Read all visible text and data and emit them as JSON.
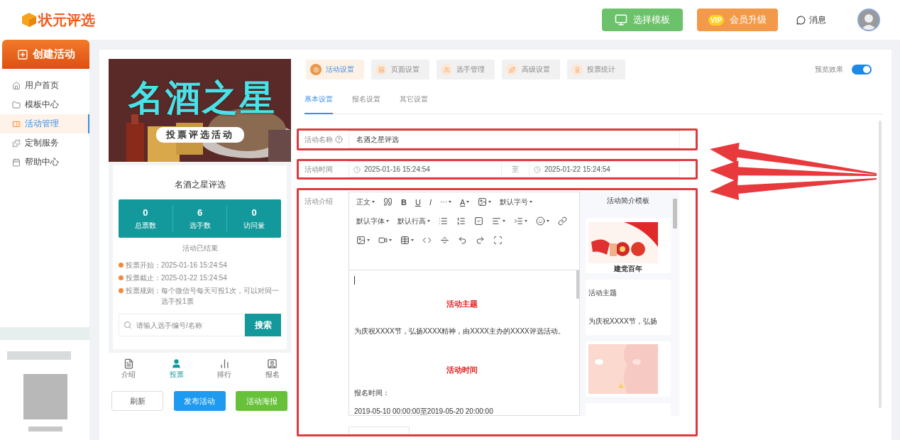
{
  "header": {
    "logo": "状元评选",
    "buttons": [
      {
        "label": "选择模板",
        "kind": "template"
      },
      {
        "label": "会员升级",
        "kind": "vip",
        "badge": "VIP"
      }
    ],
    "messages": "消息"
  },
  "sidebar": {
    "create": "创建活动",
    "items": [
      {
        "label": "用户首页",
        "selected": false
      },
      {
        "label": "模板中心",
        "selected": false
      },
      {
        "label": "活动管理",
        "selected": true
      },
      {
        "label": "定制服务",
        "selected": false
      },
      {
        "label": "帮助中心",
        "selected": false
      }
    ]
  },
  "preview": {
    "banner_title": "名酒之星",
    "banner_subtitle": "投票评选活动",
    "title": "名酒之星评选",
    "stats": [
      {
        "value": "0",
        "label": "总票数"
      },
      {
        "value": "6",
        "label": "选手数"
      },
      {
        "value": "0",
        "label": "访问量"
      }
    ],
    "status": "活动已结束",
    "rules": [
      {
        "label": "投票开始：",
        "text": "2025-01-16 15:24:54"
      },
      {
        "label": "投票截止：",
        "text": "2025-01-22 15:24:54"
      },
      {
        "label": "投票规则：",
        "text": "每个微信号每天可投1次，可以对同一选手投1票"
      }
    ],
    "search": {
      "placeholder": "请输入选手编号/名称",
      "button": "搜索"
    },
    "nav": [
      {
        "label": "介绍",
        "selected": false
      },
      {
        "label": "投票",
        "selected": true
      },
      {
        "label": "排行",
        "selected": false
      },
      {
        "label": "报名",
        "selected": false
      }
    ],
    "buttons": [
      {
        "label": "刷新",
        "kind": "plain"
      },
      {
        "label": "发布活动",
        "kind": "primary"
      },
      {
        "label": "活动海报",
        "kind": "success"
      }
    ]
  },
  "settings": {
    "tabs": [
      {
        "label": "活动设置",
        "selected": true
      },
      {
        "label": "页面设置",
        "selected": false
      },
      {
        "label": "选手管理",
        "selected": false
      },
      {
        "label": "高级设置",
        "selected": false
      },
      {
        "label": "投票统计",
        "selected": false
      }
    ],
    "preview_toggle": {
      "label": "预览效果",
      "on": true
    },
    "subtabs": [
      {
        "label": "基本设置",
        "selected": true
      },
      {
        "label": "报名设置",
        "selected": false
      },
      {
        "label": "其它设置",
        "selected": false
      }
    ],
    "name_field": {
      "label": "活动名称",
      "value": "名酒之星评选"
    },
    "time_field": {
      "label": "活动时间",
      "start": "2025-01-16 15:24:54",
      "separator": "至",
      "end": "2025-01-22 15:24:54"
    },
    "intro": {
      "label": "活动介绍",
      "toolbar_labels": [
        "正文",
        "B",
        "U",
        "I",
        "···",
        "A",
        "默认字号",
        "默认字体",
        "默认行高"
      ],
      "content": [
        {
          "kind": "heading",
          "text": "活动主题"
        },
        {
          "kind": "text",
          "text": "为庆祝XXXX节，弘扬XXXX精神，由XXXX主办的XXXX评选活动。"
        },
        {
          "kind": "heading",
          "text": "活动时间"
        },
        {
          "kind": "text",
          "text": "报名时间："
        },
        {
          "kind": "text",
          "text": "2019-05-10 00:00:00至2019-05-20 20:00:00"
        }
      ],
      "templates": {
        "title": "活动简介模板",
        "items": [
          {
            "kind": "picture",
            "caption": "建党百年"
          },
          {
            "kind": "text",
            "heading": "活动主题",
            "text": "为庆祝XXXX节，弘扬"
          },
          {
            "kind": "picture"
          },
          {
            "kind": "blank"
          }
        ]
      }
    }
  }
}
